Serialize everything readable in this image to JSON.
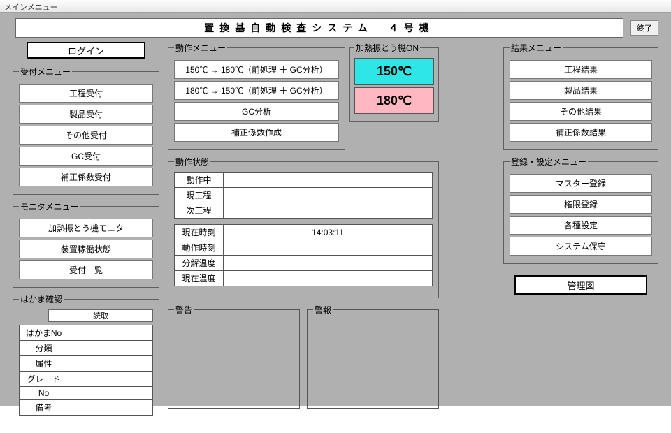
{
  "window": {
    "title": "メインメニュー"
  },
  "header": {
    "system_title": "置換基自動検査システム　４号機",
    "exit": "終了"
  },
  "login_label": "ログイン",
  "reception": {
    "legend": "受付メニュー",
    "items": [
      "工程受付",
      "製品受付",
      "その他受付",
      "GC受付",
      "補正係数受付"
    ]
  },
  "monitor": {
    "legend": "モニタメニュー",
    "items": [
      "加熱振とう機モニタ",
      "装置稼働状態",
      "受付一覧"
    ]
  },
  "hakama": {
    "legend": "はかま確認",
    "read": "読取",
    "rows": [
      "はかまNo",
      "分類",
      "属性",
      "グレード",
      "No",
      "備考"
    ]
  },
  "operation": {
    "legend": "動作メニュー",
    "items": [
      "150℃ → 180℃（前処理 ＋ GC分析）",
      "180℃ → 150℃（前処理 ＋ GC分析）",
      "GC分析",
      "補正係数作成"
    ]
  },
  "heater": {
    "legend": "加熱振とう機ON",
    "t150": "150℃",
    "t180": "180℃"
  },
  "status": {
    "legend": "動作状態",
    "rows1": [
      "動作中",
      "現工程",
      "次工程"
    ],
    "rows2_labels": [
      "現在時刻",
      "動作時刻",
      "分解温度",
      "現在温度"
    ],
    "current_time": "14:03:11"
  },
  "alarms": {
    "warning_legend": "警告",
    "alarm_legend": "警報"
  },
  "results": {
    "legend": "結果メニュー",
    "items": [
      "工程結果",
      "製品結果",
      "その他結果",
      "補正係数結果"
    ]
  },
  "register": {
    "legend": "登録・設定メニュー",
    "items": [
      "マスター登録",
      "権限登録",
      "各種設定",
      "システム保守"
    ]
  },
  "control_chart": "管理図"
}
